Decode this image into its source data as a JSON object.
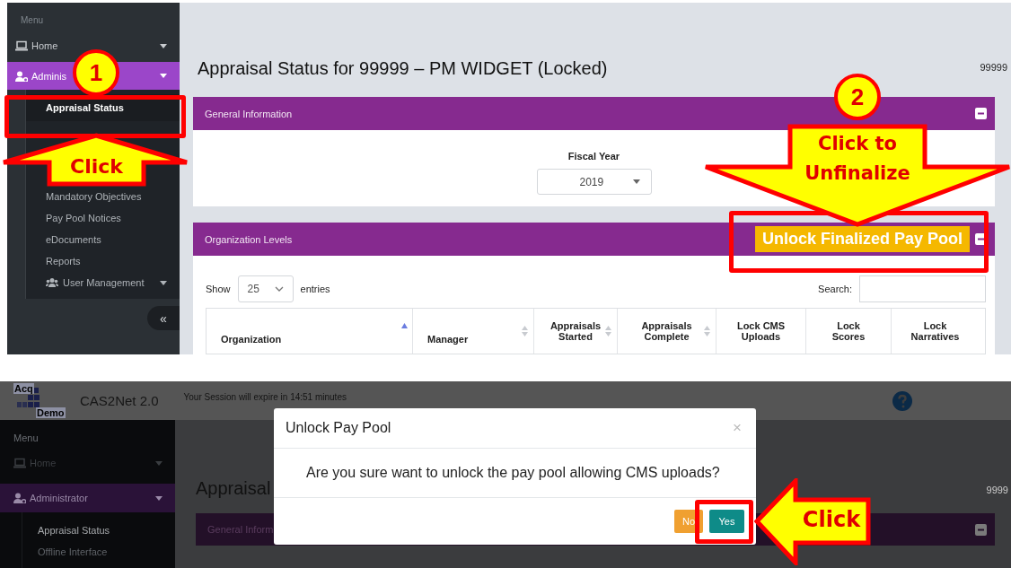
{
  "top_screen": {
    "sidebar": {
      "heading": "Menu",
      "items": [
        {
          "label": "Home",
          "selected": false
        },
        {
          "label": "Adminis",
          "selected": true
        }
      ],
      "subitems": [
        {
          "kind": "link",
          "label": "Appraisal Status",
          "selected": true
        },
        {
          "kind": "covered"
        },
        {
          "kind": "covered"
        },
        {
          "kind": "covered"
        },
        {
          "kind": "link",
          "label": "Mandatory Objectives",
          "selected": false
        },
        {
          "kind": "link",
          "label": "Pay Pool Notices",
          "selected": false
        },
        {
          "kind": "link",
          "label": "eDocuments",
          "selected": false
        },
        {
          "kind": "link",
          "label": "Reports",
          "selected": false
        },
        {
          "kind": "group",
          "label": "User Management",
          "selected": false
        }
      ],
      "collapse": "«"
    },
    "main": {
      "title": "Appraisal Status for 99999 – PM WIDGET (Locked)",
      "user_id": "99999",
      "general_panel": {
        "title": "General Information",
        "fiscal_label": "Fiscal Year",
        "fiscal_value": "2019"
      },
      "org_panel": {
        "title": "Organization Levels",
        "action": "Unlock Finalized Pay Pool",
        "show_label": "Show",
        "page_size": "25",
        "entries_label": "entries",
        "search_label": "Search:",
        "columns": [
          {
            "label": "Organization",
            "sortable": true,
            "sorted": true
          },
          {
            "label": "Manager",
            "sortable": true,
            "sorted": false
          },
          {
            "label": "Appraisals Started",
            "sortable": true,
            "sorted": false
          },
          {
            "label": "Appraisals Complete",
            "sortable": true,
            "sorted": false
          },
          {
            "label": "Lock CMS Uploads",
            "sortable": false,
            "sorted": false
          },
          {
            "label": "Lock Scores",
            "sortable": false,
            "sorted": false
          },
          {
            "label": "Lock Narratives",
            "sortable": false,
            "sorted": false
          }
        ]
      }
    },
    "annotations": [
      {
        "kind": "frame"
      },
      {
        "kind": "up-arrow",
        "text": "Click"
      },
      {
        "kind": "badge",
        "text": "1"
      },
      {
        "kind": "frame"
      },
      {
        "kind": "badge",
        "text": "2"
      },
      {
        "kind": "down-arrow",
        "text": "Click to Unfinalize"
      }
    ]
  },
  "bottom_screen": {
    "header": {
      "logo_top": "Acq",
      "logo_bottom": "Demo",
      "app_name": "CAS2Net 2.0",
      "session": "Your Session will expire in 14:51 minutes"
    },
    "sidebar": {
      "heading": "Menu",
      "items": [
        {
          "label": "Home",
          "selected": false
        },
        {
          "label": "Administrator",
          "selected": true
        }
      ],
      "subitems": [
        {
          "kind": "link",
          "label": "Appraisal Status",
          "selected": true
        },
        {
          "kind": "link",
          "label": "Offline Interface",
          "selected": false
        }
      ]
    },
    "main": {
      "title": "Appraisal",
      "user_id": "9999",
      "panel_title": "General Inform"
    },
    "dialog": {
      "title": "Unlock Pay Pool",
      "close": "×",
      "message": "Are you sure want to unlock the pay pool allowing CMS uploads?",
      "buttons": [
        {
          "label": "No",
          "kind": "warning"
        },
        {
          "label": "Yes",
          "kind": "primary"
        }
      ]
    },
    "annotations": [
      {
        "kind": "frame"
      },
      {
        "kind": "left-arrow",
        "text": "Click"
      }
    ]
  }
}
